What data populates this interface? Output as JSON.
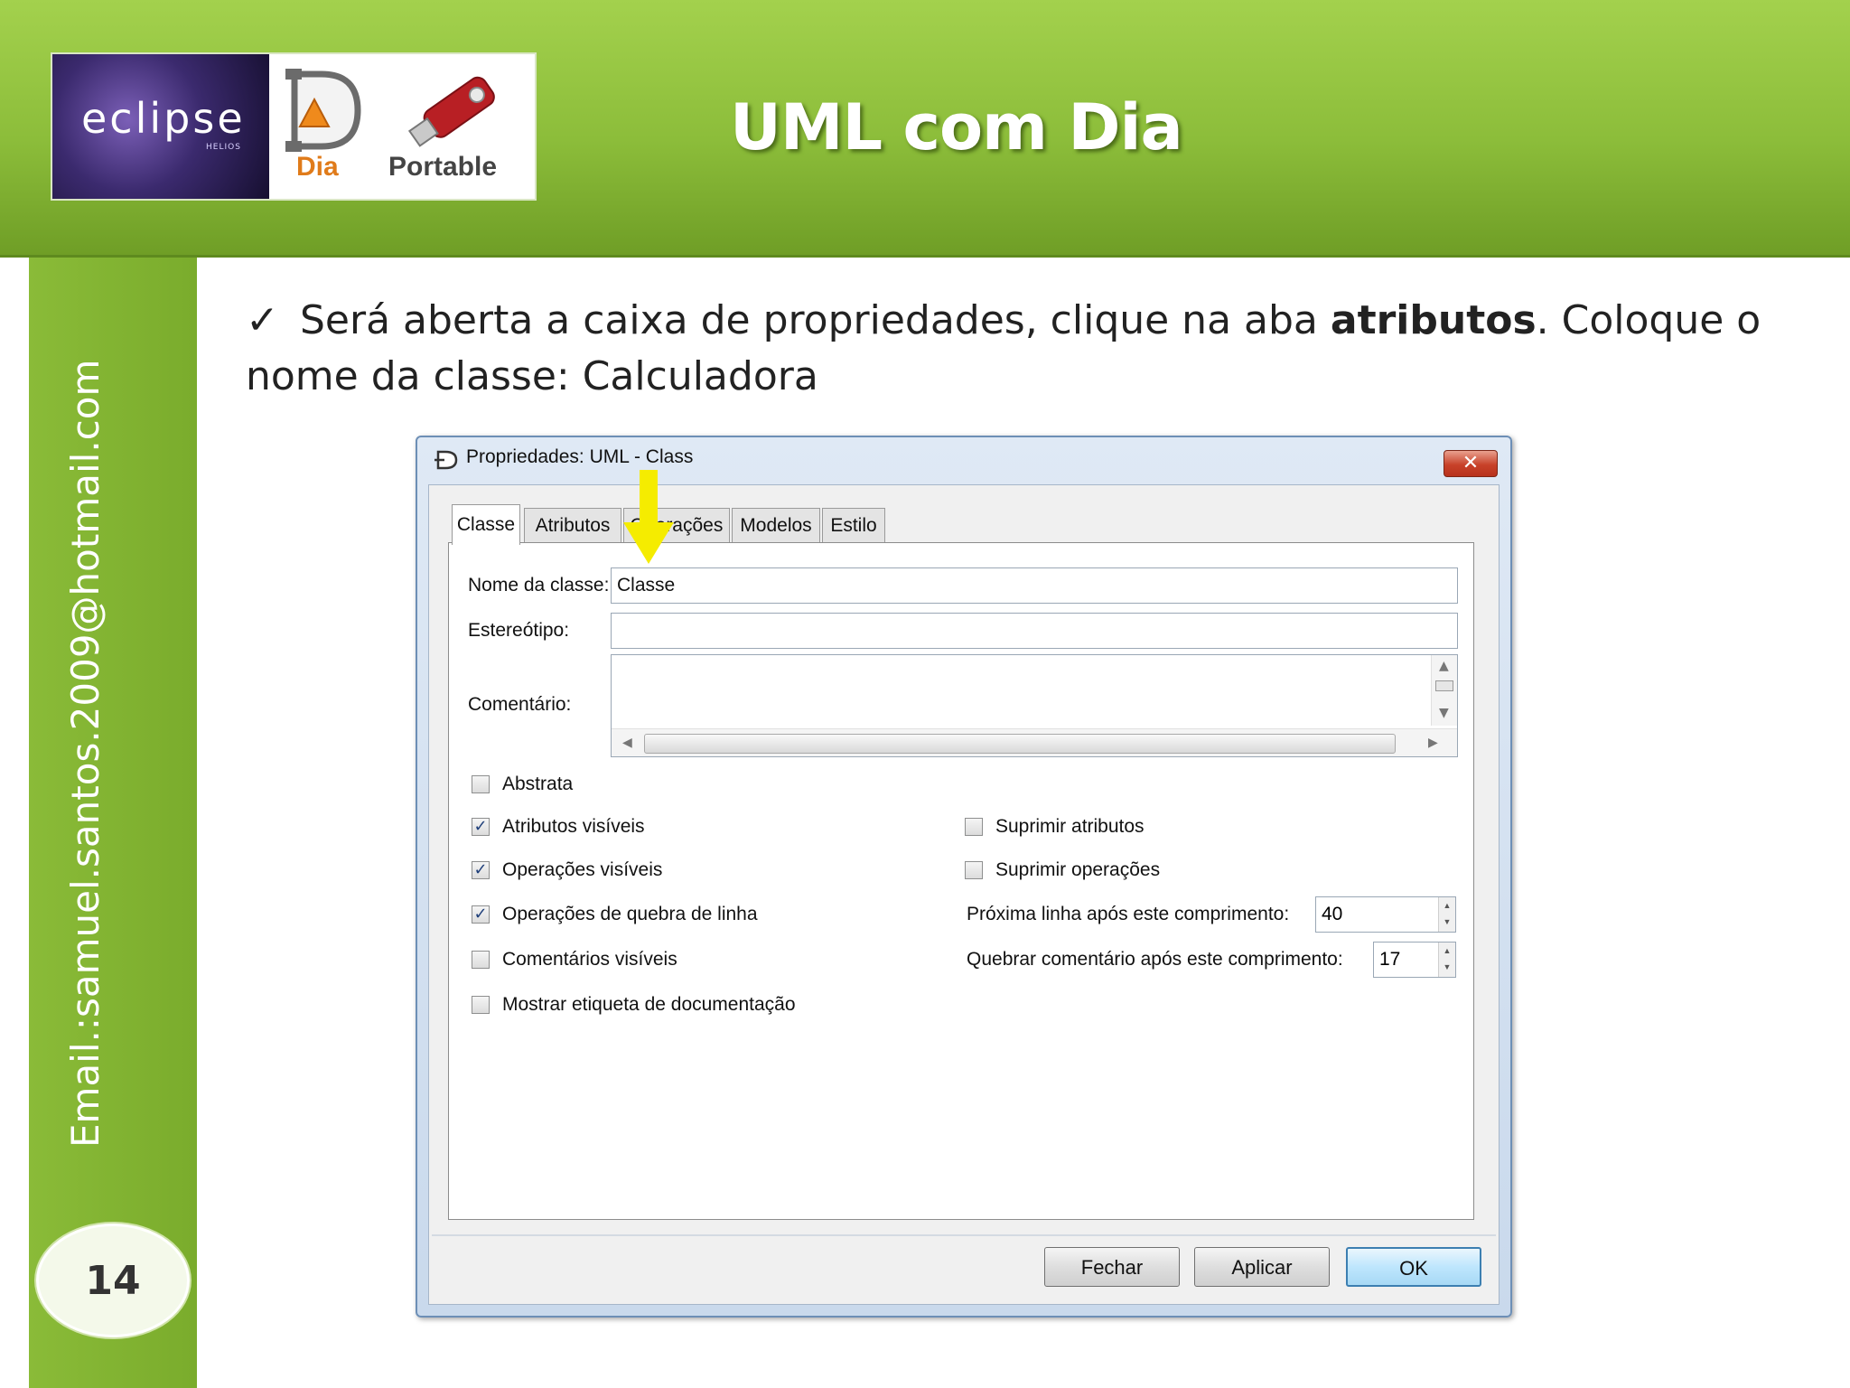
{
  "slide": {
    "title": "UML com Dia",
    "logos": {
      "eclipse": "eclipse",
      "eclipse_sub": "HELIOS",
      "dia": "Dia",
      "portable": "Portable"
    },
    "email": "Email.:samuel.santos.2009@hotmail.com",
    "page_number": "14",
    "body": {
      "part1": "Será aberta a caixa de propriedades, clique na aba ",
      "bold": "atributos",
      "part2": ". Coloque o nome da classe: Calculadora"
    }
  },
  "dialog": {
    "title": "Propriedades: UML - Class",
    "tabs": [
      "Classe",
      "Atributos",
      "Operações",
      "Modelos",
      "Estilo"
    ],
    "active_tab": "Classe",
    "fields": {
      "class_name_label": "Nome da classe:",
      "class_name_value": "Classe",
      "stereotype_label": "Estereótipo:",
      "stereotype_value": "",
      "comment_label": "Comentário:",
      "comment_value": ""
    },
    "checkboxes_left": [
      {
        "label": "Abstrata",
        "checked": false
      },
      {
        "label": "Atributos visíveis",
        "checked": true
      },
      {
        "label": "Operações visíveis",
        "checked": true
      },
      {
        "label": "Operações de quebra de linha",
        "checked": true
      },
      {
        "label": "Comentários visíveis",
        "checked": false
      },
      {
        "label": "Mostrar etiqueta de documentação",
        "checked": false
      }
    ],
    "checkboxes_right": [
      {
        "label": "Suprimir atributos",
        "checked": false
      },
      {
        "label": "Suprimir operações",
        "checked": false
      }
    ],
    "spinners": [
      {
        "label": "Próxima linha após este comprimento:",
        "value": "40"
      },
      {
        "label": "Quebrar comentário após este comprimento:",
        "value": "17"
      }
    ],
    "buttons": {
      "close": "Fechar",
      "apply": "Aplicar",
      "ok": "OK"
    }
  },
  "colors": {
    "header_green": "#8cbd3a",
    "sidebar_green": "#7aac2c",
    "arrow_yellow": "#f5ec00"
  }
}
